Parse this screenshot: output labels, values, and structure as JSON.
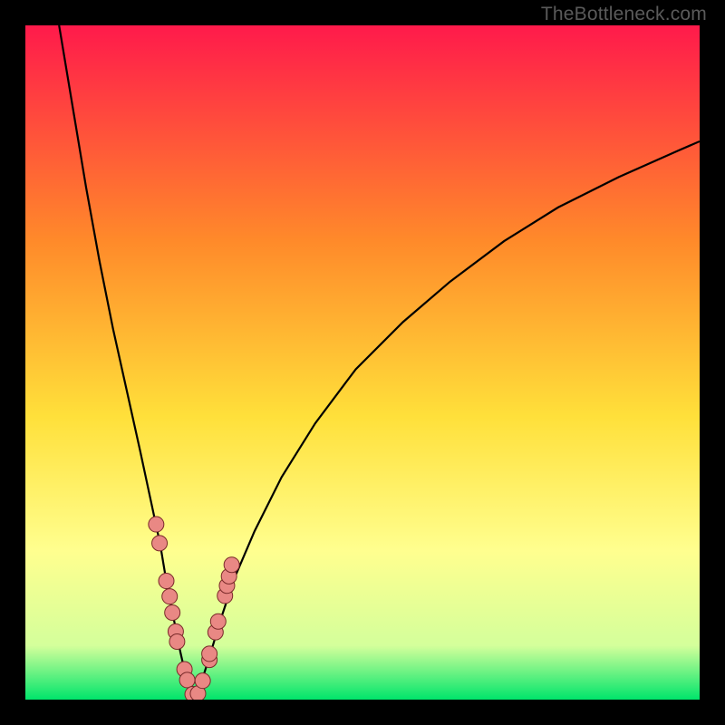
{
  "watermark": "TheBottleneck.com",
  "colors": {
    "frame": "#000000",
    "gradient_top": "#ff1a4b",
    "gradient_mid1": "#ff8a2a",
    "gradient_mid2": "#ffe03a",
    "gradient_mid3": "#ffff8f",
    "gradient_mid4": "#d4ff9b",
    "gradient_bottom": "#00e56b",
    "curve": "#000000",
    "points_fill": "#e98884",
    "points_stroke": "#7a2a2a"
  },
  "chart_data": {
    "type": "line",
    "title": "",
    "xlabel": "",
    "ylabel": "",
    "xlim": [
      0,
      100
    ],
    "ylim": [
      0,
      100
    ],
    "curve_left": {
      "x": [
        5,
        7,
        9,
        11,
        13,
        15,
        17,
        18.5,
        20,
        21,
        22,
        23,
        23.8,
        24.3,
        24.7,
        25
      ],
      "y": [
        100,
        88,
        76,
        65,
        55,
        46,
        37,
        30,
        23,
        17,
        12,
        7,
        3.5,
        1.6,
        0.5,
        0
      ]
    },
    "curve_right": {
      "x": [
        25,
        25.5,
        26.3,
        27.5,
        29,
        31,
        34,
        38,
        43,
        49,
        56,
        63,
        71,
        79,
        88,
        97,
        100
      ],
      "y": [
        0,
        1,
        3.2,
        7,
        12,
        18,
        25,
        33,
        41,
        49,
        56,
        62,
        68,
        73,
        77.5,
        81.5,
        82.8
      ]
    },
    "series": [
      {
        "name": "points",
        "x": [
          19.4,
          19.9,
          20.9,
          21.4,
          21.8,
          22.3,
          22.5,
          23.6,
          24.0,
          24.8,
          25.6,
          26.3,
          27.3,
          27.3,
          28.2,
          28.6,
          29.6,
          29.9,
          30.2,
          30.6
        ],
        "y": [
          26.0,
          23.2,
          17.6,
          15.3,
          12.9,
          10.1,
          8.6,
          4.5,
          2.9,
          0.8,
          0.9,
          2.8,
          5.9,
          6.8,
          10.0,
          11.6,
          15.4,
          16.9,
          18.3,
          20.0
        ]
      }
    ]
  }
}
